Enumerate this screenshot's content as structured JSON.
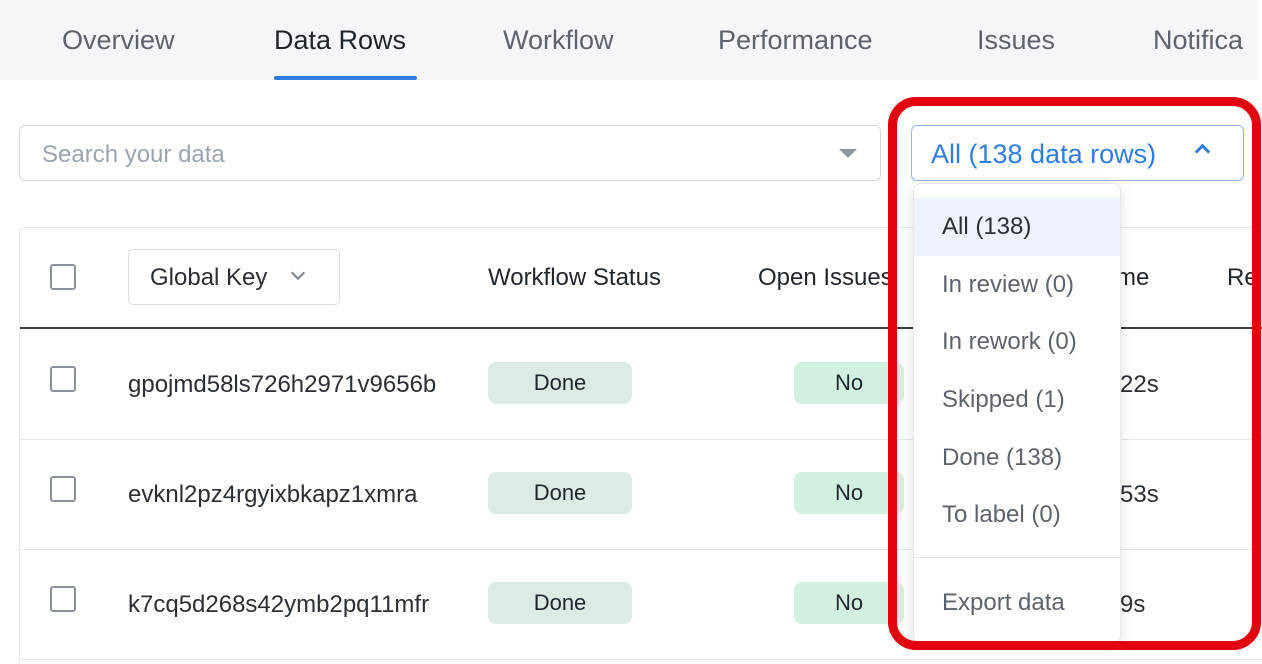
{
  "tabs": [
    {
      "label": "Overview"
    },
    {
      "label": "Data Rows"
    },
    {
      "label": "Workflow"
    },
    {
      "label": "Performance"
    },
    {
      "label": "Issues"
    },
    {
      "label": "Notifica"
    }
  ],
  "active_tab": "Data Rows",
  "search": {
    "placeholder": "Search your data",
    "value": ""
  },
  "filter": {
    "label": "All (138 data rows)"
  },
  "table": {
    "headers": {
      "global_key": "Global Key",
      "workflow_status": "Workflow Status",
      "open_issues": "Open Issues",
      "time_partial": "me",
      "next_partial": "Re"
    },
    "rows": [
      {
        "global_key": "gpojmd58ls726h2971v9656b",
        "status": "Done",
        "open_issues": "No",
        "time": "22s"
      },
      {
        "global_key": "evknl2pz4rgyixbkapz1xmra",
        "status": "Done",
        "open_issues": "No",
        "time": "53s"
      },
      {
        "global_key": "k7cq5d268s42ymb2pq11mfr",
        "status": "Done",
        "open_issues": "No",
        "time": "9s"
      }
    ]
  },
  "menu": {
    "items": [
      {
        "label": "All (138)"
      },
      {
        "label": "In review (0)"
      },
      {
        "label": "In rework (0)"
      },
      {
        "label": "Skipped (1)"
      },
      {
        "label": "Done (138)"
      },
      {
        "label": "To label (0)"
      }
    ],
    "export_label": "Export data",
    "selected": "All (138)"
  },
  "colors": {
    "accent": "#2f7de1",
    "highlight": "#e3000f",
    "done_bg": "#dcece5",
    "no_bg": "#d2f0e0"
  }
}
